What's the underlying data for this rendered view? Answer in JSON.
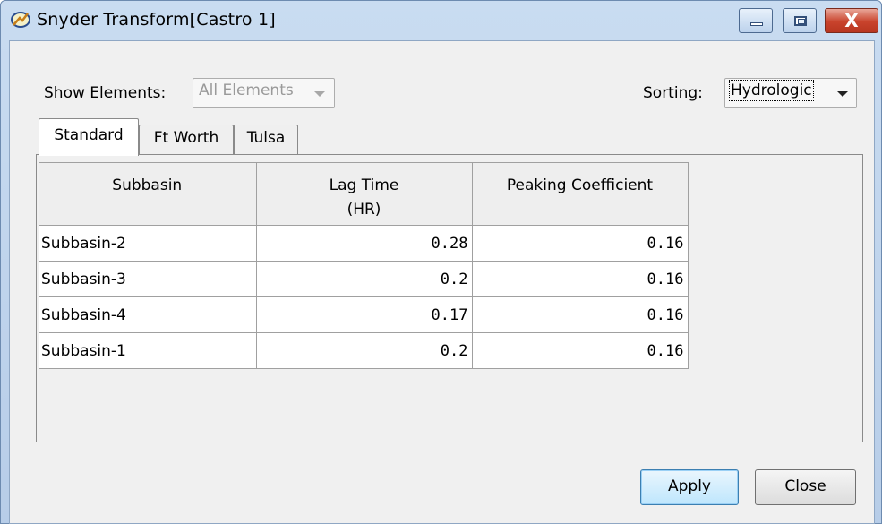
{
  "window": {
    "title": "Snyder Transform[Castro 1]",
    "icons": {
      "app": "snyder-transform-icon",
      "minimize": "minimize-icon",
      "maximize": "maximize-icon",
      "close": "close-icon"
    },
    "close_glyph": "X"
  },
  "filters": {
    "show_elements_label": "Show Elements:",
    "show_elements_value": "All Elements",
    "sorting_label": "Sorting:",
    "sorting_value": "Hydrologic"
  },
  "tabs": [
    {
      "label": "Standard",
      "active": true
    },
    {
      "label": "Ft Worth",
      "active": false
    },
    {
      "label": "Tulsa",
      "active": false
    }
  ],
  "table": {
    "headers": [
      {
        "line1": "Subbasin",
        "line2": ""
      },
      {
        "line1": "Lag Time",
        "line2": "(HR)"
      },
      {
        "line1": "Peaking Coefficient",
        "line2": ""
      }
    ],
    "rows": [
      {
        "name": "Subbasin-2",
        "lag": "0.28",
        "peak": "0.16"
      },
      {
        "name": "Subbasin-3",
        "lag": "0.2",
        "peak": "0.16"
      },
      {
        "name": "Subbasin-4",
        "lag": "0.17",
        "peak": "0.16"
      },
      {
        "name": "Subbasin-1",
        "lag": "0.2",
        "peak": "0.16"
      }
    ]
  },
  "buttons": {
    "apply": "Apply",
    "close": "Close"
  },
  "colors": {
    "title_bar": "#c9dcf1",
    "close_button": "#c9432c",
    "default_button": "#bee6fd"
  }
}
